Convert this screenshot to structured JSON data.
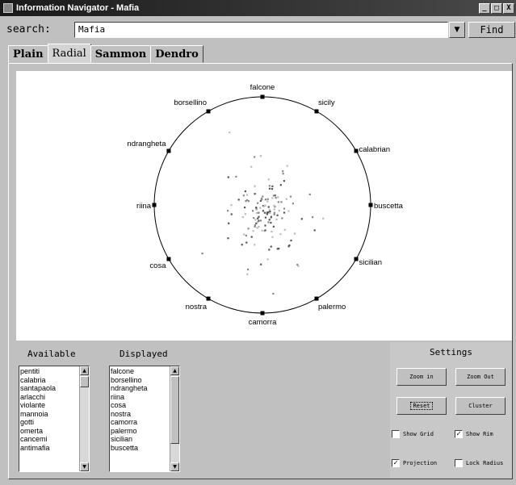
{
  "window": {
    "title": "Information Navigator - Mafia",
    "minimize": "_",
    "maximize": "□",
    "close": "X"
  },
  "search": {
    "label": "search:",
    "value": "Mafia",
    "dropdown_glyph": "▼",
    "find_label": "Find"
  },
  "tabs": [
    {
      "label": "Plain",
      "active": false
    },
    {
      "label": "Radial",
      "active": true
    },
    {
      "label": "Sammon",
      "active": false
    },
    {
      "label": "Dendro",
      "active": false
    }
  ],
  "radial": {
    "anchors": [
      "falcone",
      "sicily",
      "calabrian",
      "buscetta",
      "sicilian",
      "palermo",
      "camorra",
      "nostra",
      "cosa",
      "riina",
      "ndrangheta",
      "borsellino"
    ],
    "point_colors": [
      "#555555",
      "#888888",
      "#bbbbbb"
    ]
  },
  "lists": {
    "available_header": "Available",
    "displayed_header": "Displayed",
    "available": [
      "pentiti",
      "calabria",
      "santapaola",
      "arlacchi",
      "violante",
      "mannoia",
      "gotti",
      "omerta",
      "cancemi",
      "antimafia"
    ],
    "displayed": [
      "falcone",
      "borsellino",
      "ndrangheta",
      "riina",
      "cosa",
      "nostra",
      "camorra",
      "palermo",
      "sicilian",
      "buscetta"
    ]
  },
  "settings": {
    "title": "Settings",
    "zoom_in": "Zoom in",
    "zoom_out": "Zoom Out",
    "reset": "Reset",
    "cluster": "Cluster",
    "show_grid": {
      "label": "Show Grid",
      "checked": false
    },
    "show_rim": {
      "label": "Show Rim",
      "checked": true
    },
    "projection": {
      "label": "Projection",
      "checked": true
    },
    "lock_radius": {
      "label": "Lock Radius",
      "checked": false
    }
  }
}
